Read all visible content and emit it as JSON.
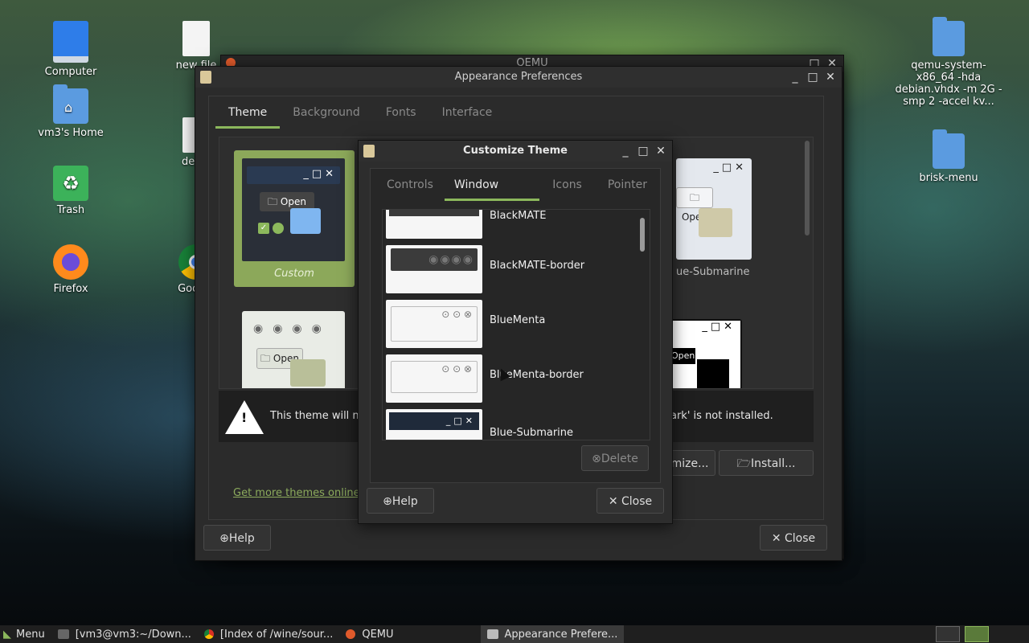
{
  "desktop": {
    "icons": [
      {
        "label": "Computer",
        "icon": "computer-icon"
      },
      {
        "label": "vm3's Home",
        "icon": "home-folder-icon"
      },
      {
        "label": "Trash",
        "icon": "trash-icon"
      },
      {
        "label": "Firefox",
        "icon": "firefox-icon"
      },
      {
        "label": "new file",
        "icon": "file-icon"
      },
      {
        "label": "debia",
        "icon": "file-icon"
      },
      {
        "label": "Google",
        "icon": "chrome-icon"
      },
      {
        "label": "qemu-system-x86_64 -hda debian.vhdx -m 2G -smp 2 -accel kv...",
        "icon": "folder-icon"
      },
      {
        "label": "brisk-menu",
        "icon": "folder-icon"
      }
    ]
  },
  "qemu_window": {
    "title": "QEMU"
  },
  "appearance": {
    "title": "Appearance Preferences",
    "tabs": [
      "Theme",
      "Background",
      "Fonts",
      "Interface"
    ],
    "active_tab": "Theme",
    "themes": [
      {
        "label": "Custom",
        "open_label": "Open"
      },
      {
        "label": "ue-Submarine",
        "open_label": "Open"
      },
      {
        "label": "",
        "open_label": "Open"
      },
      {
        "label": "",
        "open_label": "Open"
      }
    ],
    "warning_text_left": "This theme will no",
    "warning_text_right": "ark' is not installed.",
    "customize_button": "mize...",
    "install_button": "Install...",
    "more_themes_link": "Get more themes online",
    "help_button": "Help",
    "close_button": "Close"
  },
  "customize": {
    "title": "Customize Theme",
    "tabs": [
      "Controls",
      "Window Border",
      "Icons",
      "Pointer"
    ],
    "active_tab": "Window Border",
    "items": [
      "BlackMATE",
      "BlackMATE-border",
      "BlueMenta",
      "BlueMenta-border",
      "Blue-Submarine"
    ],
    "delete_button": "Delete",
    "help_button": "Help",
    "close_button": "Close"
  },
  "taskbar": {
    "menu_label": "Menu",
    "tasks": [
      "[vm3@vm3:~/Down...",
      "[Index of /wine/sour...",
      "QEMU",
      "Appearance Prefere..."
    ],
    "active_task": "Appearance Prefere..."
  },
  "colors": {
    "accent": "#8cb85c",
    "window_bg": "#2b2b2b",
    "selection": "#8ca85a"
  }
}
